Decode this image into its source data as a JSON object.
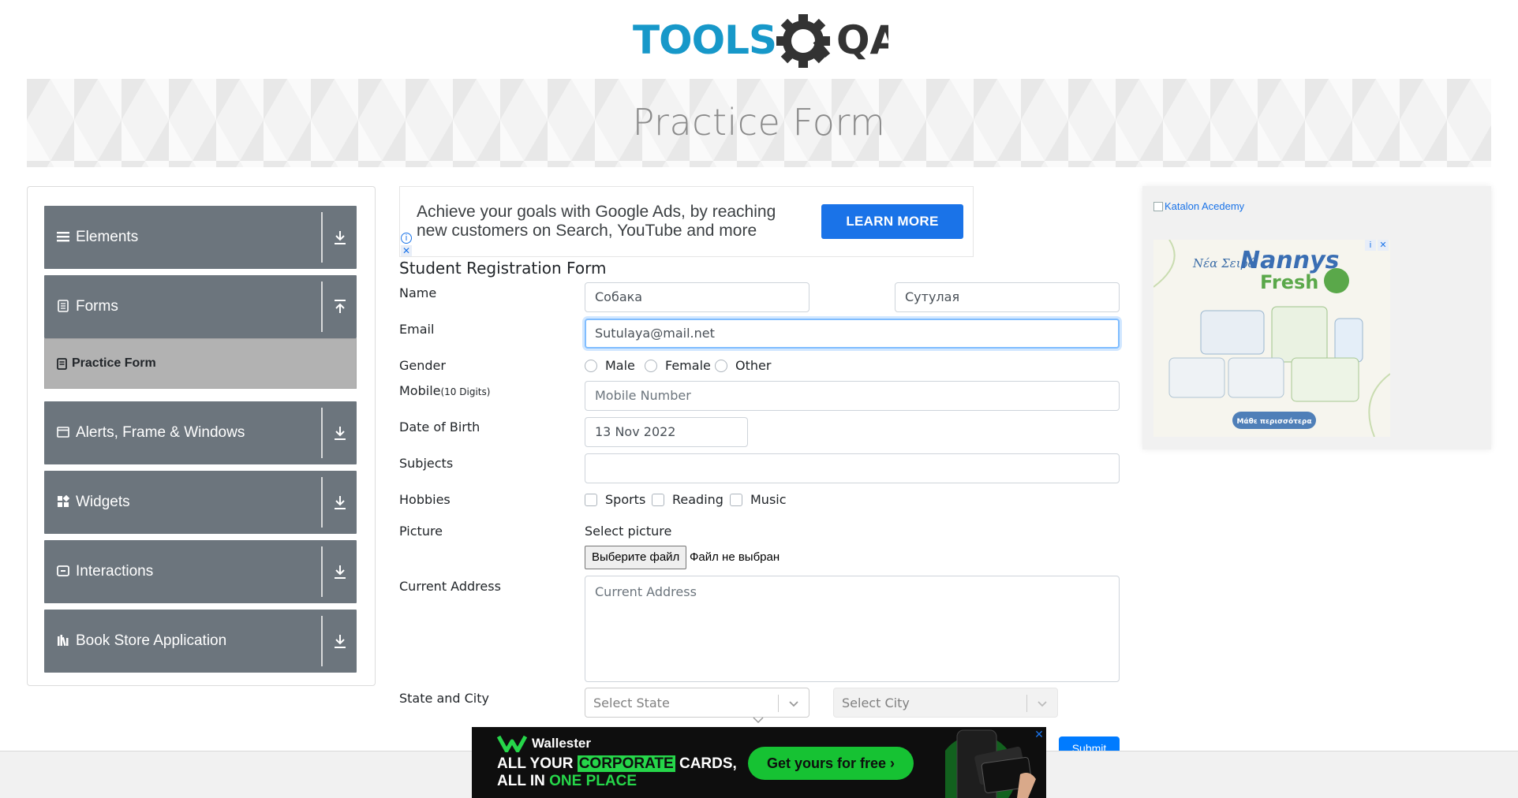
{
  "brand": {
    "logo_text_left": "TOOLS",
    "logo_text_right": "QA"
  },
  "page": {
    "title": "Practice Form"
  },
  "sidebar": {
    "groups": [
      {
        "label": "Elements",
        "icon": "menu-icon",
        "expanded": false
      },
      {
        "label": "Forms",
        "icon": "form-icon",
        "expanded": true,
        "items": [
          {
            "label": "Practice Form",
            "icon": "document-icon",
            "active": true
          }
        ]
      },
      {
        "label": "Alerts, Frame & Windows",
        "icon": "window-icon",
        "expanded": false
      },
      {
        "label": "Widgets",
        "icon": "widgets-icon",
        "expanded": false
      },
      {
        "label": "Interactions",
        "icon": "interactions-icon",
        "expanded": false
      },
      {
        "label": "Book Store Application",
        "icon": "books-icon",
        "expanded": false
      }
    ]
  },
  "ad_top": {
    "text": "Achieve your goals with Google Ads, by reaching new customers on Search, YouTube and more",
    "button": "LEARN MORE"
  },
  "form": {
    "title": "Student Registration Form",
    "name": {
      "label": "Name",
      "first_value": "Собака",
      "last_value": "Сутулая"
    },
    "email": {
      "label": "Email",
      "value": "Sutulaya@mail.net"
    },
    "gender": {
      "label": "Gender",
      "options": [
        "Male",
        "Female",
        "Other"
      ]
    },
    "mobile": {
      "label": "Mobile",
      "hint": "(10 Digits)",
      "placeholder": "Mobile Number"
    },
    "dob": {
      "label": "Date of Birth",
      "value": "13 Nov 2022"
    },
    "subjects": {
      "label": "Subjects",
      "value": ""
    },
    "hobbies": {
      "label": "Hobbies",
      "options": [
        "Sports",
        "Reading",
        "Music"
      ]
    },
    "picture": {
      "label": "Picture",
      "caption": "Select picture",
      "button": "Выберите файл",
      "status": "Файл не выбран"
    },
    "address": {
      "label": "Current Address",
      "placeholder": "Current Address"
    },
    "state_city": {
      "label": "State and City",
      "state_placeholder": "Select State",
      "city_placeholder": "Select City"
    },
    "submit": "Submit"
  },
  "ad_right": {
    "alt_text": "Katalon Acedemy",
    "brand": "Nannys",
    "brand_sub": "Fresh",
    "cta": "Μάθε περισσότερα",
    "tag": "Νέα Σειρά"
  },
  "ad_bottom": {
    "brand": "Wallester",
    "line1_a": "ALL YOUR ",
    "line1_b": "CORPORATE",
    "line1_c": " CARDS,",
    "line2_a": "ALL IN ",
    "line2_b": "ONE PLACE",
    "cta": "Get yours for free"
  },
  "colors": {
    "accent": "#007bff",
    "sidebar_group": "#6c757d",
    "sidebar_active": "#b2b2b2",
    "logo_blue": "#1798c9",
    "logo_dark": "#333333"
  }
}
